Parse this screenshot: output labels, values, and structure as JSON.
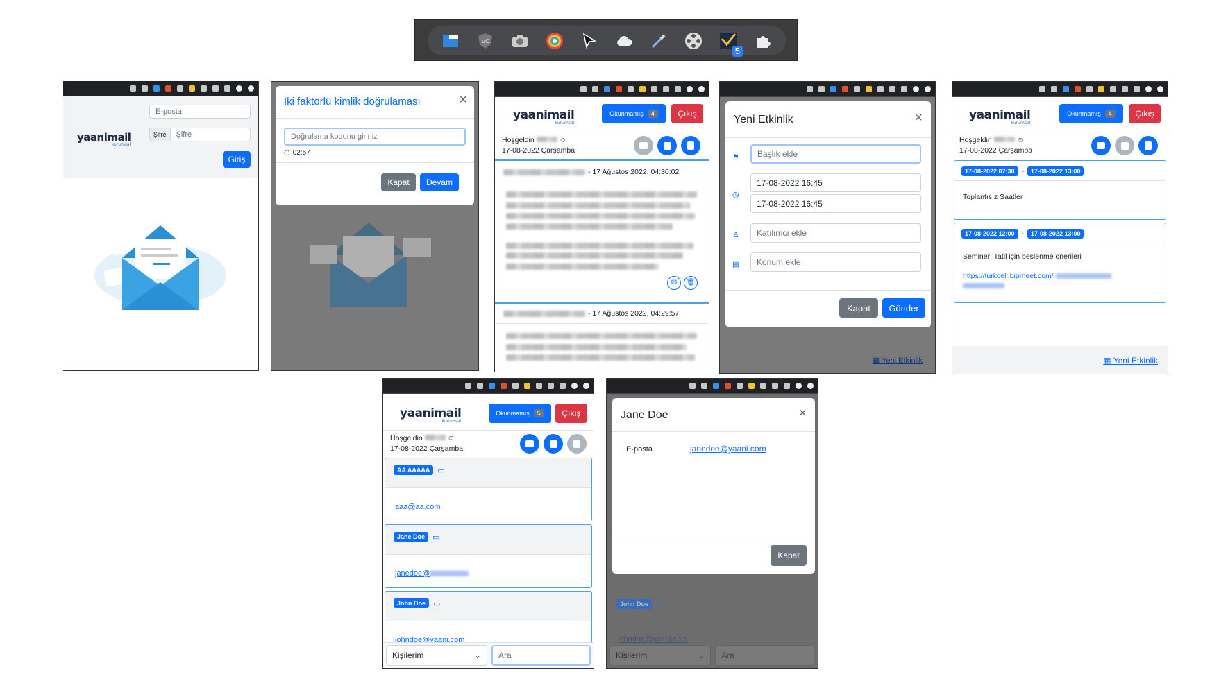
{
  "extensions_toolbar": {
    "icons": [
      "window-icon",
      "ublock-icon",
      "camera-icon",
      "color-picker-icon",
      "cursor-icon",
      "cloud-icon",
      "eyedropper-icon",
      "film-reel-icon",
      "yaani-check-icon",
      "puzzle-icon"
    ],
    "badge": "5"
  },
  "brand": {
    "logo_main": "yaani",
    "logo_accent": "mail",
    "logo_sub": "kurumsal"
  },
  "login": {
    "email_placeholder": "E-posta",
    "password_label": "Şifre",
    "password_placeholder": "Şifre",
    "submit": "Giriş"
  },
  "twofa": {
    "title": "İki faktörlü kimlik doğrulaması",
    "code_placeholder": "Doğrulama kodunu giriniz",
    "timer": "02:57",
    "close_label": "Kapat",
    "continue_label": "Devam"
  },
  "header": {
    "unread_label": "Okunmamış",
    "logout_label": "Çıkış",
    "greeting": "Hoşgeldin",
    "date_line": "17-08-2022 Çarşamba"
  },
  "mail_list": {
    "unread_count": "4",
    "items": [
      {
        "date": "- 17 Ağustos 2022, 04:30:02"
      },
      {
        "date": "- 17 Ağustos 2022, 04:29:57"
      }
    ]
  },
  "new_event": {
    "title": "Yeni Etkinlik",
    "title_placeholder": "Başlık ekle",
    "start": "17-08-2022 16:45",
    "end": "17-08-2022 16:45",
    "attendee_placeholder": "Katılımcı ekle",
    "location_placeholder": "Konum ekle",
    "close_label": "Kapat",
    "send_label": "Gönder",
    "footer_link": "Yeni Etkinlik"
  },
  "calendar": {
    "unread_count": "4",
    "events": [
      {
        "start": "17-08-2022 07:30",
        "end": "17-08-2022 13:00",
        "title": "Toplantısız Saatler",
        "link": ""
      },
      {
        "start": "17-08-2022 12:00",
        "end": "17-08-2022 13:00",
        "title": "Seminer: Tatil için beslenme önerileri",
        "link": "https://turkcell.bipmeet.com/"
      }
    ],
    "footer_link": "Yeni Etkinlik",
    "separator": "-"
  },
  "contacts": {
    "unread_count": "5",
    "items": [
      {
        "name": "AA AAAAA",
        "email": "aaa@aa.com"
      },
      {
        "name": "Jane Doe",
        "email": "janedoe@"
      },
      {
        "name": "John Doe",
        "email": "johndoe@yaani.com"
      }
    ],
    "select_value": "Kişilerim",
    "search_placeholder": "Ara"
  },
  "contact_detail": {
    "name": "Jane Doe",
    "email_label": "E-posta",
    "email": "janedoe@yaani.com",
    "close_label": "Kapat"
  }
}
